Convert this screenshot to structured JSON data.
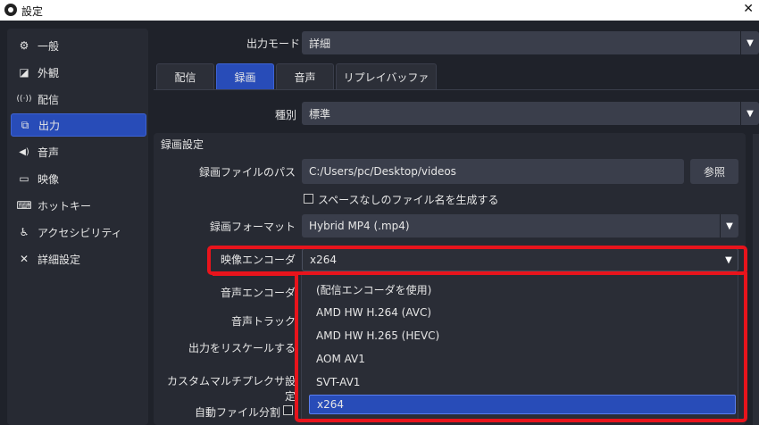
{
  "window": {
    "title": "設定",
    "close": "✕"
  },
  "sidebar": {
    "items": [
      {
        "label": "一般",
        "icon": "gear-icon",
        "glyph": "⚙"
      },
      {
        "label": "外観",
        "icon": "appearance-icon",
        "glyph": "◪"
      },
      {
        "label": "配信",
        "icon": "broadcast-icon",
        "glyph": "((·))"
      },
      {
        "label": "出力",
        "icon": "output-icon",
        "glyph": "⧉"
      },
      {
        "label": "音声",
        "icon": "speaker-icon",
        "glyph": "◀)"
      },
      {
        "label": "映像",
        "icon": "monitor-icon",
        "glyph": "▭"
      },
      {
        "label": "ホットキー",
        "icon": "keyboard-icon",
        "glyph": "⌨"
      },
      {
        "label": "アクセシビリティ",
        "icon": "accessibility-icon",
        "glyph": "♿"
      },
      {
        "label": "詳細設定",
        "icon": "tools-icon",
        "glyph": "✕"
      }
    ],
    "active_index": 3
  },
  "output_mode": {
    "label": "出力モード",
    "value": "詳細"
  },
  "tabs": [
    "配信",
    "録画",
    "音声",
    "リプレイバッファ"
  ],
  "type": {
    "label": "種別",
    "value": "標準"
  },
  "group": {
    "title": "録画設定",
    "path_label": "録画ファイルのパス",
    "path_value": "C:/Users/pc/Desktop/videos",
    "browse": "参照",
    "nospace_label": "スペースなしのファイル名を生成する",
    "format_label": "録画フォーマット",
    "format_value": "Hybrid MP4 (.mp4)",
    "encoder_label": "映像エンコーダ",
    "encoder_value": "x264",
    "audio_encoder_label": "音声エンコーダ",
    "audio_track_label": "音声トラック",
    "rescale_label": "出力をリスケールする",
    "mux_label": "カスタムマルチプレクサ設定",
    "autosplit_label": "自動ファイル分割"
  },
  "encoder_options": [
    "(配信エンコーダを使用)",
    "AMD HW H.264 (AVC)",
    "AMD HW H.265 (HEVC)",
    "AOM AV1",
    "SVT-AV1",
    "x264"
  ],
  "colors": {
    "accent": "#284cb8",
    "highlight": "#e8141c",
    "background": "#1f222a"
  }
}
